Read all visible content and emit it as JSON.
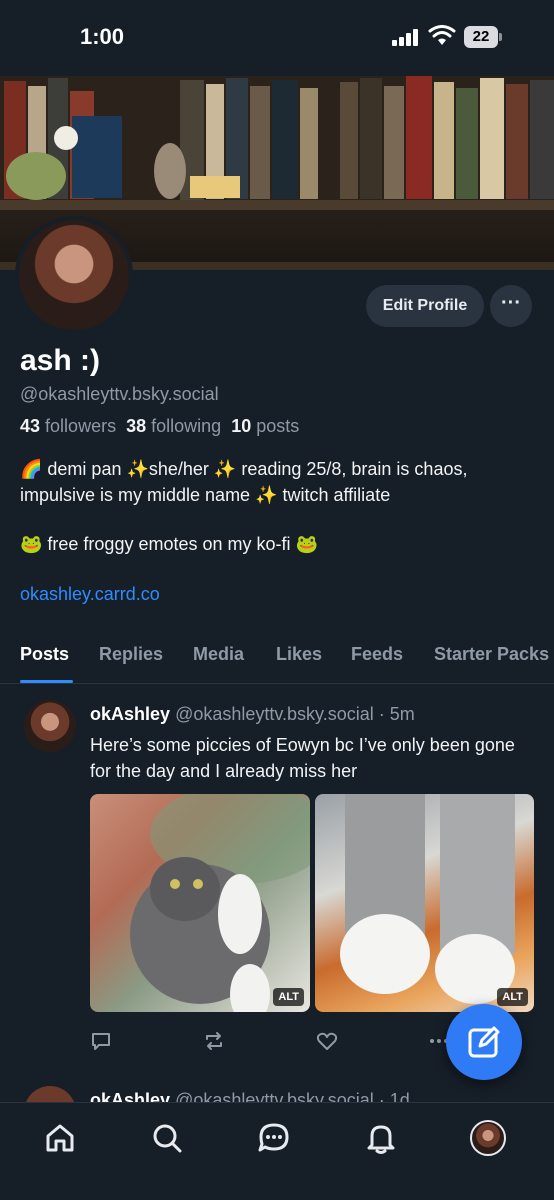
{
  "status_bar": {
    "time": "1:00",
    "battery": "22"
  },
  "profile": {
    "display_name": "ash :)",
    "handle": "@okashleyttv.bsky.social",
    "followers_count": "43",
    "followers_label": "followers",
    "following_count": "38",
    "following_label": "following",
    "posts_count": "10",
    "posts_label": "posts",
    "bio_line1": "🌈 demi pan ✨she/her ✨ reading 25/8, brain is chaos, impulsive is my middle name ✨ twitch affiliate",
    "bio_line2": "🐸 free froggy emotes on my ko-fi 🐸",
    "link": "okashley.carrd.co",
    "edit_button": "Edit Profile",
    "more_button": "···"
  },
  "tabs": [
    {
      "label": "Posts",
      "active": true
    },
    {
      "label": "Replies"
    },
    {
      "label": "Media"
    },
    {
      "label": "Likes"
    },
    {
      "label": "Feeds"
    },
    {
      "label": "Starter Packs"
    }
  ],
  "posts": [
    {
      "author_name": "okAshley",
      "author_handle": "@okashleyttv.bsky.social",
      "time": "· 5m",
      "text": "Here’s some piccies of Eowyn bc I’ve only been gone for the day and I already miss her",
      "images": [
        {
          "alt_badge": "ALT"
        },
        {
          "alt_badge": "ALT"
        }
      ]
    },
    {
      "author_name": "okAshley",
      "author_handle": "@okashleyttv.bsky.social",
      "time": "· 1d"
    }
  ],
  "icons": {
    "reply": "reply-icon",
    "repost": "repost-icon",
    "like": "heart-icon",
    "more": "more-icon",
    "compose": "compose-icon",
    "home": "home-icon",
    "search": "search-icon",
    "chat": "chat-icon",
    "notifications": "bell-icon"
  },
  "colors": {
    "background": "#161e27",
    "accent": "#2f8cff",
    "muted": "#8f9aa7"
  }
}
